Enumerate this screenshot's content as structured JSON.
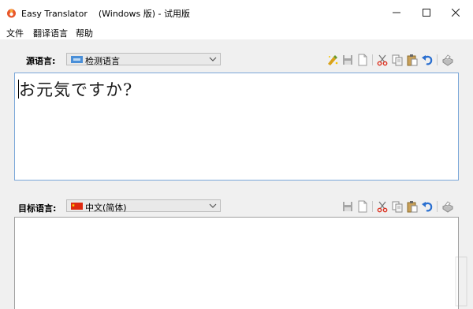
{
  "window": {
    "title": "Easy Translator    (Windows 版) - 试用版",
    "controls": [
      "minimize",
      "maximize",
      "close"
    ]
  },
  "menu": {
    "items": [
      "文件",
      "翻译语言",
      "帮助"
    ]
  },
  "source": {
    "label": "源语言:",
    "selected_language": "检测语言",
    "text": "お元気ですか?",
    "toolbar_icons": [
      "translate-icon",
      "save-icon",
      "new-icon",
      "cut-icon",
      "copy-icon",
      "paste-icon",
      "undo-icon",
      "print-icon"
    ]
  },
  "target": {
    "label": "目标语言:",
    "selected_language": "中文(简体)",
    "text": "",
    "toolbar_icons": [
      "save-icon",
      "new-icon",
      "cut-icon",
      "copy-icon",
      "paste-icon",
      "undo-icon",
      "print-icon"
    ]
  },
  "colors": {
    "client_bg": "#f0f0f0",
    "source_border_focus": "#7aa7d8",
    "china_flag_red": "#de2910",
    "detect_flag_blue": "#4a8fd8"
  }
}
